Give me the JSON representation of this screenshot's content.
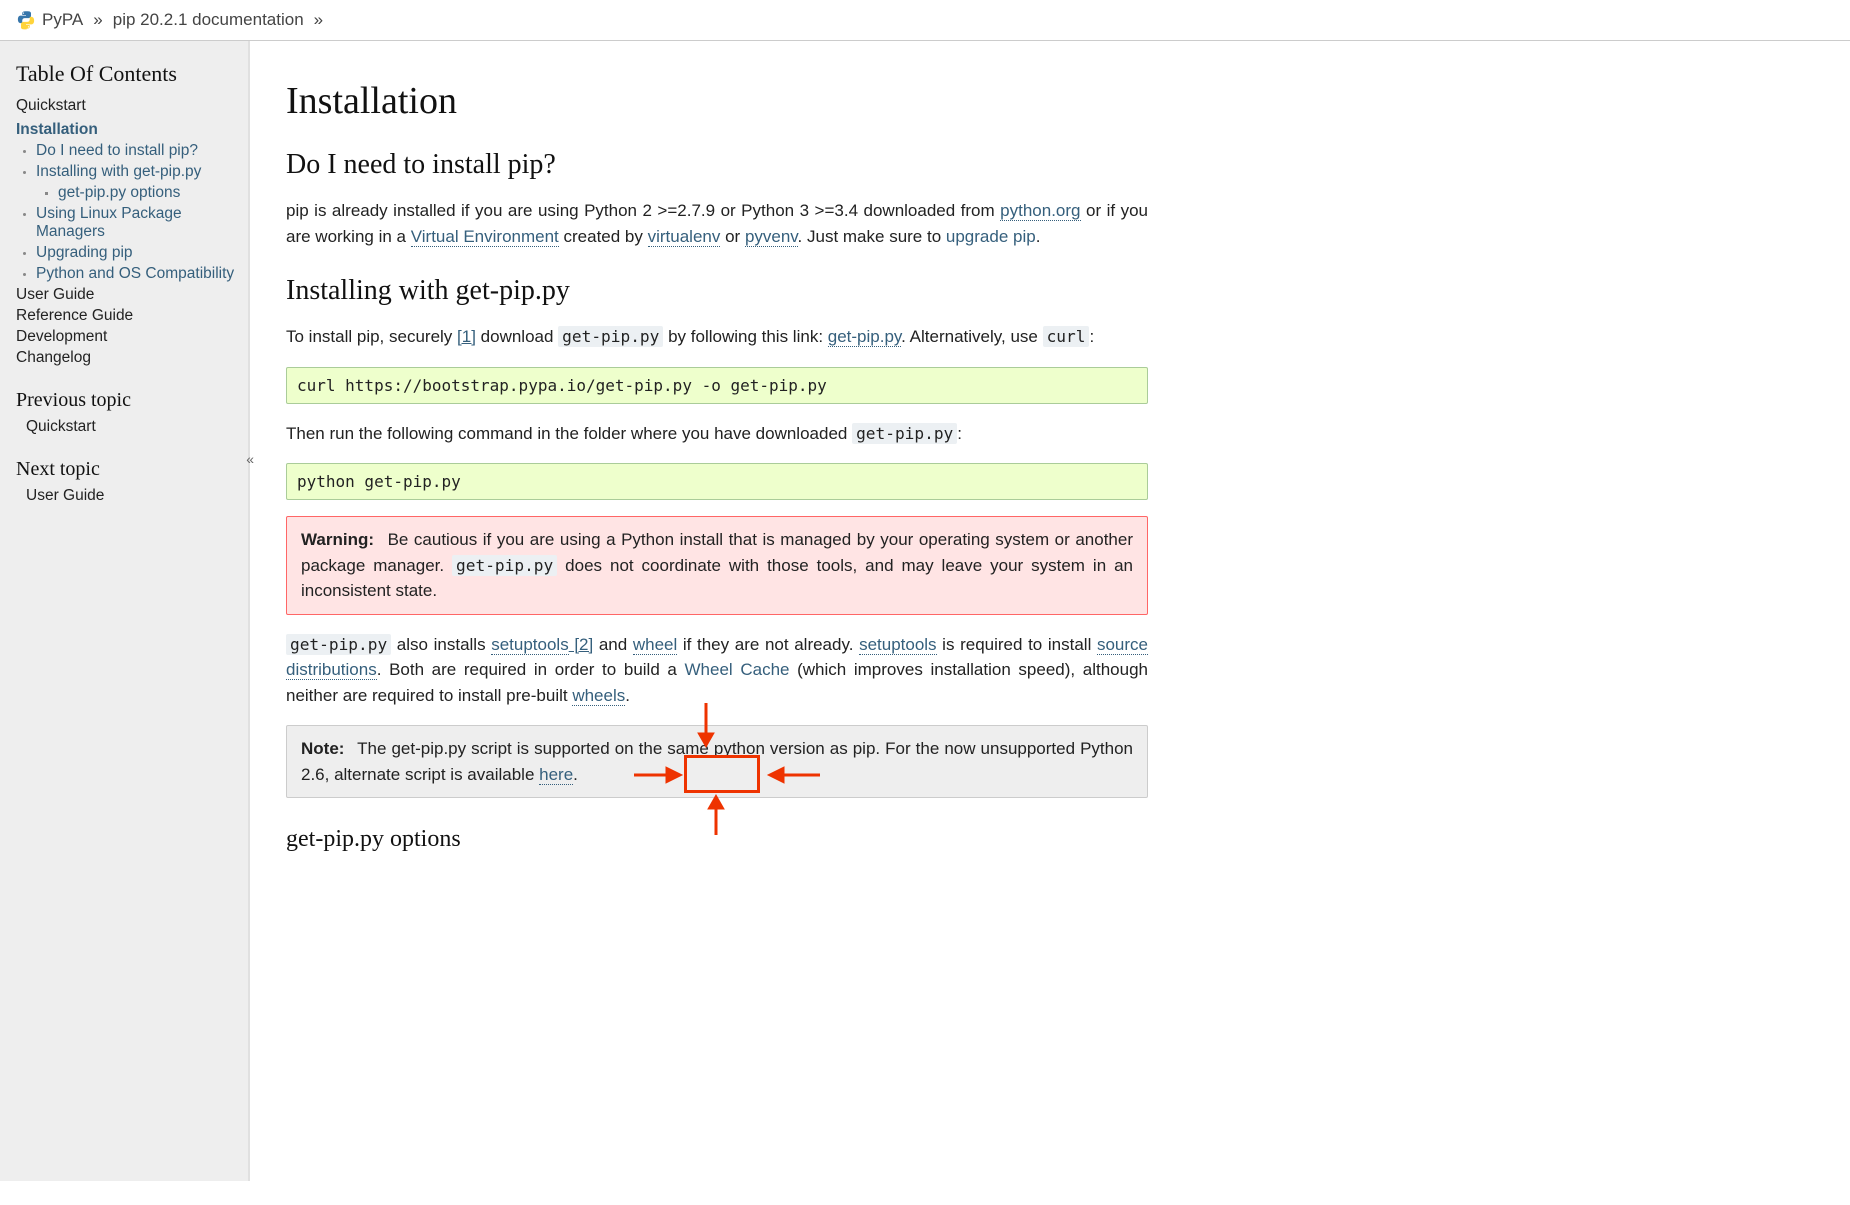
{
  "breadcrumb": {
    "item1": "PyPA",
    "item2": "pip 20.2.1 documentation",
    "sep": "»"
  },
  "sidebar": {
    "toc_title": "Table Of Contents",
    "items": [
      {
        "label": "Quickstart",
        "link": true
      },
      {
        "label": "Installation",
        "link": true,
        "current": true,
        "children": [
          {
            "label": "Do I need to install pip?"
          },
          {
            "label": "Installing with get-pip.py",
            "children": [
              {
                "label": "get-pip.py options"
              }
            ]
          },
          {
            "label": "Using Linux Package Managers"
          },
          {
            "label": "Upgrading pip"
          },
          {
            "label": "Python and OS Compatibility"
          }
        ]
      },
      {
        "label": "User Guide"
      },
      {
        "label": "Reference Guide"
      },
      {
        "label": "Development"
      },
      {
        "label": "Changelog"
      }
    ],
    "prev_heading": "Previous topic",
    "prev_label": "Quickstart",
    "next_heading": "Next topic",
    "next_label": "User Guide",
    "collapse": "«"
  },
  "content": {
    "h1": "Installation",
    "s1": {
      "h2": "Do I need to install pip?",
      "p1a": "pip is already installed if you are using Python 2 >=2.7.9 or Python 3 >=3.4 downloaded from ",
      "python_org": "python.org",
      "p1b": " or if you are working in a ",
      "venv": "Virtual Environment",
      "p1c": " created by ",
      "virtualenv": "virtualenv",
      "p1d": " or ",
      "pyvenv": "pyvenv",
      "p1e": ". Just make sure to ",
      "upgrade": "upgrade pip",
      "p1f": "."
    },
    "s2": {
      "h2": "Installing with get-pip.py",
      "p1a": "To install pip, securely ",
      "ref1": "[1]",
      "p1b": " download ",
      "code1": "get-pip.py",
      "p1c": " by following this link: ",
      "link_getpip": "get-pip.py",
      "p1d": ". Alternatively, use ",
      "code_curl": "curl",
      "p1e": ":",
      "pre1": "curl https://bootstrap.pypa.io/get-pip.py -o get-pip.py",
      "p2a": "Then run the following command in the folder where you have downloaded ",
      "code2": "get-pip.py",
      "p2b": ":",
      "pre2": "python get-pip.py",
      "warn_title": "Warning:",
      "warn_a": " Be cautious if you are using a Python install that is managed by your operating system or another package manager. ",
      "warn_code": "get-pip.py",
      "warn_b": " does not coordinate with those tools, and may leave your system in an inconsistent state.",
      "p3code": "get-pip.py",
      "p3a": " also installs ",
      "setuptools": "setuptools",
      "ref2": " [2]",
      "p3b": " and ",
      "wheel": "wheel",
      "p3c": " if they are not already. ",
      "setuptools2": "setuptools",
      "p3d": " is required to install ",
      "sdist": "source distributions",
      "p3e": ". Both are required in order to build a ",
      "wheelcache": "Wheel Cache",
      "p3f": " (which improves installation speed), although neither are required to install pre-built ",
      "wheels": "wheels",
      "p3g": ".",
      "note_title": "Note:",
      "note_a": " The get-pip.py script is supported on the same python version as pip. For the now unsupported Python 2.6, alternate script is available ",
      "note_here": "here",
      "note_b": "."
    },
    "s3": {
      "h3": "get-pip.py options"
    }
  }
}
